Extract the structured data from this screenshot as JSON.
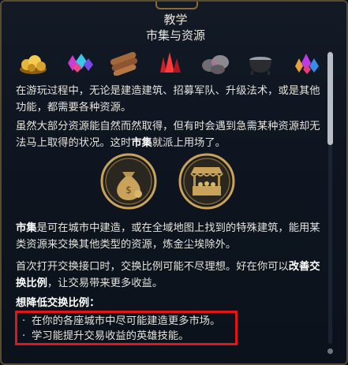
{
  "header": {
    "title": "教学",
    "subtitle": "市集与资源"
  },
  "resources": [
    {
      "icon": "gold-resource-icon"
    },
    {
      "icon": "gems-resource-icon"
    },
    {
      "icon": "wood-resource-icon"
    },
    {
      "icon": "crystal-resource-icon"
    },
    {
      "icon": "ore-resource-icon"
    },
    {
      "icon": "mercury-cauldron-resource-icon"
    },
    {
      "icon": "mixed-gems-resource-icon"
    }
  ],
  "content": {
    "para1": "在游玩过程中，无论是建造建筑、招募军队、升级法术，或是其他功能，都需要各种资源。",
    "para2_pre": "虽然大部分资源能自然而然取得，但有时会遇到急需某种资源却无法马上取得的状况。这时",
    "para2_bold": "市集",
    "para2_post": "就派上用场了。",
    "para3_bold": "市集",
    "para3_post": "是可在城市中建造，或在全域地图上找到的特殊建筑，能用某类资源来交换其他类型的资源，炼金尘埃除外。",
    "para4_pre": "首次打开交换接口时，交换比例可能不尽理想。好在你可以",
    "para4_bold": "改善交换比例",
    "para4_post": "，让交易带来更多收益。",
    "tips_title": "想降低交换比例：",
    "tips": [
      "在你的各座城市中尽可能建造更多市场。",
      "学习能提升交易收益的英雄技能。"
    ],
    "bullet": "·"
  },
  "colors": {
    "gold_accent": "#c9a35a",
    "highlight_border": "#e0161b",
    "background": "#0e1520"
  }
}
